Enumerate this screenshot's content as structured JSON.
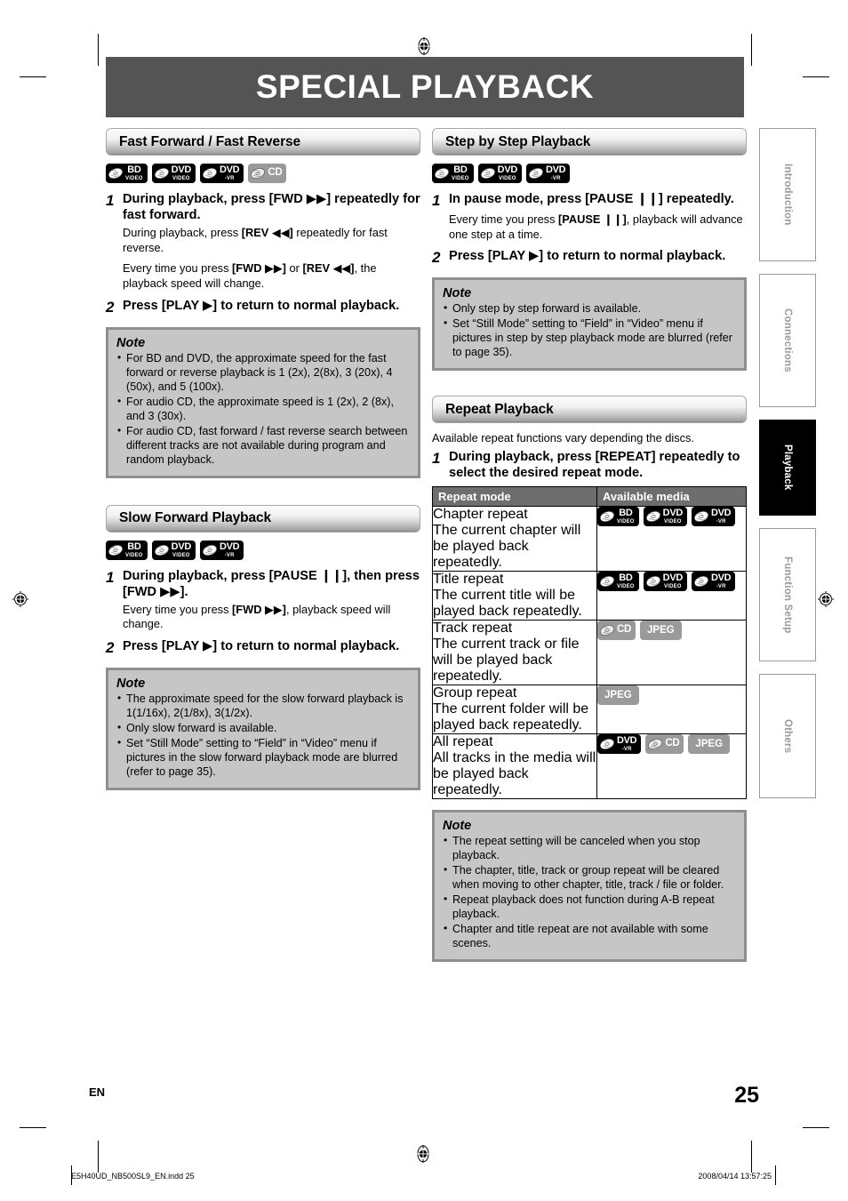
{
  "page": {
    "title": "SPECIAL PLAYBACK",
    "language_code": "EN",
    "page_number": "25",
    "footer_file": "E5H40UD_NB500SL9_EN.indd   25",
    "footer_timestamp": "2008/04/14   13:57:25"
  },
  "side_tabs": [
    {
      "label": "Introduction",
      "active": false
    },
    {
      "label": "Connections",
      "active": false
    },
    {
      "label": "Playback",
      "active": true
    },
    {
      "label": "Function Setup",
      "active": false
    },
    {
      "label": "Others",
      "active": false
    }
  ],
  "badges": {
    "bd_video": {
      "big": "BD",
      "sub": "Video",
      "style": "dark"
    },
    "dvd_video": {
      "big": "DVD",
      "sub": "Video",
      "style": "dark"
    },
    "dvd_vr": {
      "big": "DVD",
      "sub": "-VR",
      "style": "dark"
    },
    "cd": {
      "big": "CD",
      "sub": "",
      "style": "gray"
    },
    "jpeg": {
      "big": "JPEG",
      "sub": "",
      "style": "plain"
    }
  },
  "sections": {
    "fast_forward": {
      "heading": "Fast Forward / Fast Reverse",
      "media": [
        "bd_video",
        "dvd_video",
        "dvd_vr",
        "cd"
      ],
      "steps": [
        {
          "num": "1",
          "head": "During playback, press [FWD ▶▶] repeatedly for fast forward.",
          "paras": [
            "During playback, press [REV ◀◀] repeatedly for fast reverse.",
            "Every time you press [FWD ▶▶] or [REV ◀◀], the playback speed will change."
          ]
        },
        {
          "num": "2",
          "head": "Press [PLAY ▶] to return to normal playback.",
          "paras": []
        }
      ],
      "note": {
        "title": "Note",
        "items": [
          "For BD and DVD, the approximate speed for the fast forward or reverse playback is 1 (2x), 2(8x), 3 (20x), 4 (50x), and 5 (100x).",
          "For audio CD, the approximate speed is 1 (2x), 2 (8x), and 3 (30x).",
          "For audio CD, fast forward / fast reverse search between different tracks are not available during program and random playback."
        ]
      }
    },
    "slow_forward": {
      "heading": "Slow Forward Playback",
      "media": [
        "bd_video",
        "dvd_video",
        "dvd_vr"
      ],
      "steps": [
        {
          "num": "1",
          "head": "During playback, press [PAUSE ❙❙], then press [FWD ▶▶].",
          "paras": [
            "Every time you press [FWD ▶▶], playback speed will change."
          ]
        },
        {
          "num": "2",
          "head": "Press [PLAY ▶] to return to normal playback.",
          "paras": []
        }
      ],
      "note": {
        "title": "Note",
        "items": [
          "The approximate speed for the slow forward playback is 1(1/16x), 2(1/8x), 3(1/2x).",
          "Only slow forward is available.",
          "Set “Still Mode” setting to “Field” in “Video” menu if pictures in the slow forward playback mode are blurred (refer to page 35)."
        ]
      }
    },
    "step_by_step": {
      "heading": "Step by Step Playback",
      "media": [
        "bd_video",
        "dvd_video",
        "dvd_vr"
      ],
      "steps": [
        {
          "num": "1",
          "head": "In pause mode, press [PAUSE ❙❙] repeatedly.",
          "paras": [
            "Every time you press [PAUSE ❙❙], playback will advance one step at a time."
          ]
        },
        {
          "num": "2",
          "head": "Press [PLAY ▶] to return to normal playback.",
          "paras": []
        }
      ],
      "note": {
        "title": "Note",
        "items": [
          "Only step by step forward is available.",
          "Set “Still Mode” setting to “Field” in “Video” menu if pictures in step by step playback mode are blurred (refer to page 35)."
        ]
      }
    },
    "repeat": {
      "heading": "Repeat Playback",
      "intro": "Available repeat functions vary depending the discs.",
      "steps": [
        {
          "num": "1",
          "head": "During playback, press [REPEAT] repeatedly to select the desired repeat mode.",
          "paras": []
        }
      ],
      "table": {
        "columns": [
          "Repeat mode",
          "Available media"
        ],
        "rows": [
          {
            "mode": "Chapter repeat",
            "desc": "The current chapter will be played back repeatedly.",
            "media": [
              "bd_video",
              "dvd_video",
              "dvd_vr"
            ]
          },
          {
            "mode": "Title repeat",
            "desc": "The current title will be played back repeatedly.",
            "media": [
              "bd_video",
              "dvd_video",
              "dvd_vr"
            ]
          },
          {
            "mode": "Track repeat",
            "desc": "The current track or file will be played back repeatedly.",
            "media": [
              "cd",
              "jpeg"
            ]
          },
          {
            "mode": "Group repeat",
            "desc": "The current folder will be played back repeatedly.",
            "media": [
              "jpeg"
            ]
          },
          {
            "mode": "All repeat",
            "desc": "All tracks in the media will be played back repeatedly.",
            "media": [
              "dvd_vr",
              "cd",
              "jpeg"
            ]
          }
        ]
      },
      "note": {
        "title": "Note",
        "items": [
          "The repeat setting will be canceled when you stop playback.",
          "The chapter, title, track or group repeat will be cleared when moving to other chapter, title, track / file or folder.",
          "Repeat playback does not function during A-B repeat playback.",
          "Chapter and title repeat are not available with some scenes."
        ]
      }
    }
  }
}
